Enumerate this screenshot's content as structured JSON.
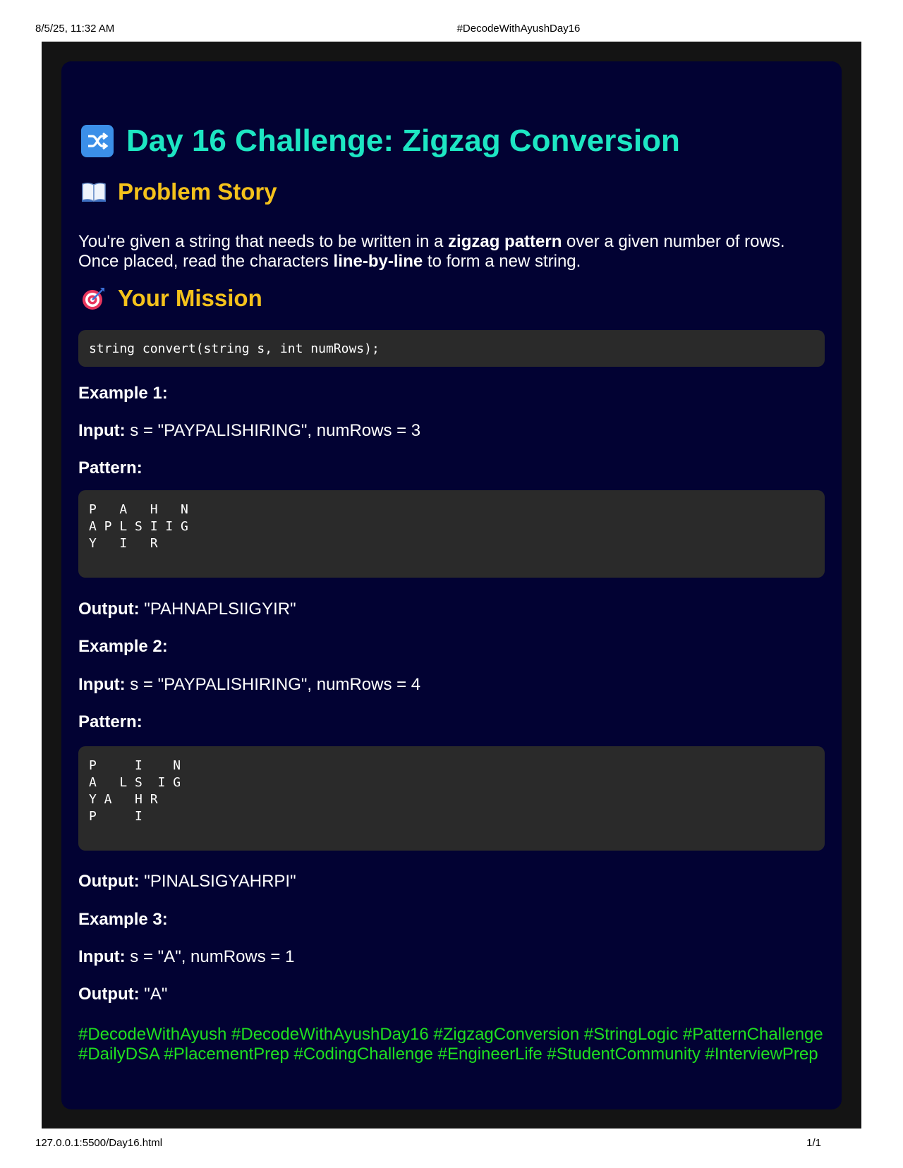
{
  "print_header": {
    "datetime": "8/5/25, 11:32 AM",
    "title": "#DecodeWithAyushDay16"
  },
  "print_footer": {
    "url": "127.0.0.1:5500/Day16.html",
    "page": "1/1"
  },
  "heading": {
    "icon": "shuffle-icon",
    "text": "Day 16 Challenge: Zigzag Conversion"
  },
  "story": {
    "icon": "open-book-icon",
    "title": "Problem Story",
    "t1": "You're given a string that needs to be written in a ",
    "b1": "zigzag pattern",
    "t2": " over a given number of rows. Once placed, read the characters ",
    "b2": "line-by-line",
    "t3": " to form a new string."
  },
  "mission": {
    "icon": "target-icon",
    "title": "Your Mission",
    "signature": "string convert(string s, int numRows);"
  },
  "examples": [
    {
      "title": "Example 1:",
      "input_label": "Input:",
      "input_value": " s = \"PAYPALISHIRING\", numRows = 3",
      "pattern_label": "Pattern:",
      "pattern": "P   A   H   N\nA P L S I I G\nY   I   R",
      "output_label": "Output:",
      "output_value": " \"PAHNAPLSIIGYIR\""
    },
    {
      "title": "Example 2:",
      "input_label": "Input:",
      "input_value": " s = \"PAYPALISHIRING\", numRows = 4",
      "pattern_label": "Pattern:",
      "pattern": "P     I    N\nA   L S  I G\nY A   H R\nP     I",
      "output_label": "Output:",
      "output_value": " \"PINALSIGYAHRPI\""
    },
    {
      "title": "Example 3:",
      "input_label": "Input:",
      "input_value": " s = \"A\", numRows = 1",
      "output_label": "Output:",
      "output_value": " \"A\""
    }
  ],
  "hashtags": "#DecodeWithAyush #DecodeWithAyushDay16 #ZigzagConversion #StringLogic #PatternChallenge #DailyDSA #PlacementPrep #CodingChallenge #EngineerLife #StudentCommunity #InterviewPrep",
  "colors": {
    "background": "#020233",
    "heading": "#1de6c3",
    "subheading": "#f5c21b",
    "hashtags": "#1fe01f",
    "code_bg": "#2a2a2a"
  }
}
